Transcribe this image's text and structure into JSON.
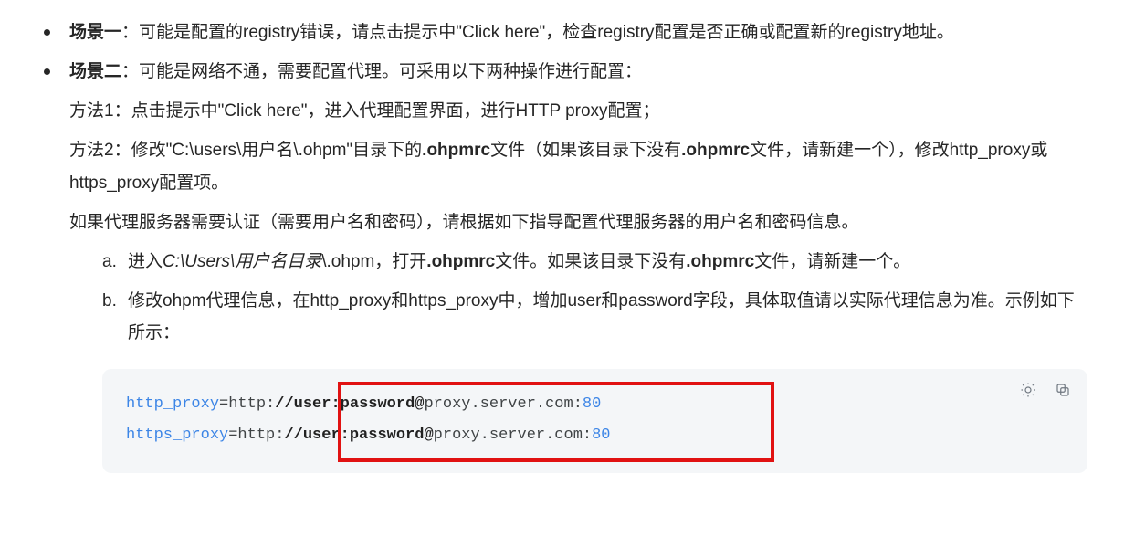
{
  "scenarios": [
    {
      "label": "场景一",
      "rest": "：可能是配置的registry错误，请点击提示中\"Click here\"，检查registry配置是否正确或配置新的registry地址。"
    },
    {
      "label": "场景二",
      "rest": "：可能是网络不通，需要配置代理。可采用以下两种操作进行配置：",
      "method1": "方法1：点击提示中\"Click here\"，进入代理配置界面，进行HTTP proxy配置；",
      "method2_a": "方法2：修改\"C:\\users\\用户名\\.ohpm\"目录下的",
      "method2_bold1": ".ohpmrc",
      "method2_b": "文件（如果该目录下没有",
      "method2_bold2": ".ohpmrc",
      "method2_c": "文件，请新建一个），修改http_proxy或https_proxy配置项。",
      "auth_note": "如果代理服务器需要认证（需要用户名和密码），请根据如下指导配置代理服务器的用户名和密码信息。",
      "steps": [
        {
          "marker": "a.",
          "pre": "进入",
          "italic": "C:\\Users\\用户名目录",
          "mid1": "\\.ohpm，打开",
          "bold1": ".ohpmrc",
          "mid2": "文件。如果该目录下没有",
          "bold2": ".ohpmrc",
          "tail": "文件，请新建一个。"
        },
        {
          "marker": "b.",
          "text": "修改ohpm代理信息，在http_proxy和https_proxy中，增加user和password字段，具体取值请以实际代理信息为准。示例如下所示："
        }
      ]
    }
  ],
  "code": {
    "lines": [
      {
        "key": "http_proxy",
        "eq": "=http:",
        "hl": "//user:password@",
        "host": "proxy.server.com:",
        "port": "80"
      },
      {
        "key": "https_proxy",
        "eq": "=http:",
        "hl": "//user:password@",
        "host": "proxy.server.com:",
        "port": "80"
      }
    ]
  },
  "icons": {
    "theme": "theme",
    "copy": "copy"
  }
}
